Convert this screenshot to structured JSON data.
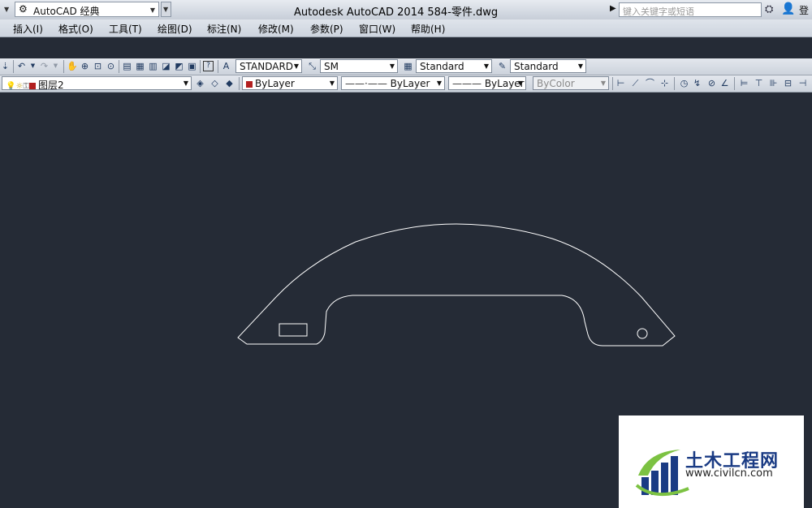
{
  "titlebar": {
    "workspace": "AutoCAD 经典",
    "title": "Autodesk AutoCAD 2014    584-零件.dwg",
    "search_placeholder": "键入关键字或短语",
    "login": "登"
  },
  "menu": [
    "插入(I)",
    "格式(O)",
    "工具(T)",
    "绘图(D)",
    "标注(N)",
    "修改(M)",
    "参数(P)",
    "窗口(W)",
    "帮助(H)"
  ],
  "styles_toolbar": {
    "text_style": "STANDARD",
    "dim_style": "SM",
    "table_style": "Standard",
    "mleader_style": "Standard"
  },
  "layers_toolbar": {
    "layer": "图层2",
    "color": "ByLayer",
    "linetype": "ByLayer",
    "lineweight": "ByLayer",
    "plotstyle": "ByColor"
  },
  "watermark": {
    "text_cn": "土木工程网",
    "url": "www.civilcn.com"
  },
  "colors": {
    "canvas": "#252b36",
    "drawing_line": "#ffffff",
    "layer_color": "#b21f1f",
    "logo_blue": "#1a3b84",
    "logo_green": "#7cc242"
  }
}
